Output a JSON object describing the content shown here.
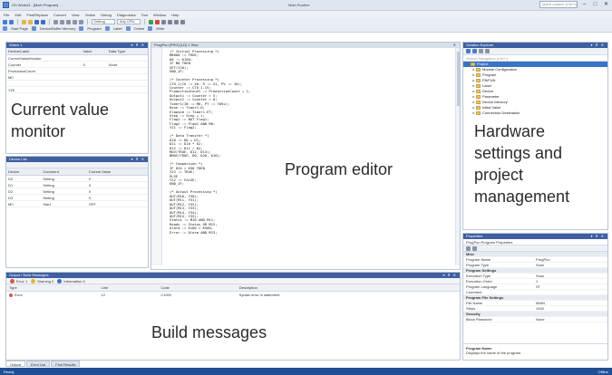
{
  "window": {
    "title": "GX Works3 - [Main Program] ...",
    "center_title": "Main Routine",
    "search_placeholder": "Quick Launch (Ctrl+Q)",
    "controls": [
      "–",
      "□",
      "✕"
    ]
  },
  "menu": [
    "File",
    "Edit",
    "Find/Replace",
    "Convert",
    "View",
    "Online",
    "Debug",
    "Diagnostics",
    "Tool",
    "Window",
    "Help"
  ],
  "toolbar": {
    "dropdown_1": "Debug",
    "dropdown_2": "Any CPU",
    "labels_row2": [
      "Start Page",
      "Device/Buffer Memory",
      "Program",
      "Label",
      "Online",
      "Write"
    ]
  },
  "monitor": {
    "overlay": [
      "Current value",
      "monitor"
    ],
    "header": "Watch 1",
    "columns": [
      "Device/Label",
      "Value",
      "Data Type"
    ],
    "rows": [
      [
        "CurrentValueMonitor",
        "",
        ""
      ],
      [
        "Counter",
        "0",
        "Word"
      ],
      [
        "ProductionCount",
        "",
        ""
      ],
      [
        "M0",
        "",
        ""
      ],
      [
        "",
        "",
        ""
      ],
      [
        "Y20",
        "",
        ""
      ]
    ]
  },
  "devices": {
    "header": "Device List",
    "columns": [
      "Device",
      "Comment",
      "Current Value"
    ],
    "rows": [
      [
        "D0",
        "Setting",
        "0"
      ],
      [
        "D1",
        "Setting",
        "0"
      ],
      [
        "D2",
        "Setting",
        "0"
      ],
      [
        "D3",
        "Setting",
        "0"
      ],
      [
        "M0",
        "Start",
        "OFF"
      ]
    ]
  },
  "editor": {
    "header": "ProgPou [PRG] [LD] 1 Step",
    "overlay": "Program editor",
    "lines": [
      "(* Initial Processing *)",
      "M8000 := TRUE;",
      "D0 := K100;",
      "IF M0 THEN",
      "  SET(Y20);",
      "END_IF;",
      "",
      "(* Counter Processing *)",
      "CTU_1(CU := X0, R := X1, PV := 10);",
      "Counter := CTU_1.CV;",
      "ProductionCount := ProductionCount + 1;",
      "Output1 := Counter > 5;",
      "Output2 := Counter > 8;",
      "Timer1(IN := M0, PT := T#5s);",
      "Done := Timer1.Q;",
      "Elapsed := Timer1.ET;",
      "Step := Step + 1;",
      "Flag1 := NOT Flag1;",
      "Flag2 := Flag1 AND M0;",
      "Y21 := Flag2;",
      "",
      "(* Data Transfer *)",
      "D10 := D0 + D1;",
      "D11 := D10 * K2;",
      "D12 := D11 / K4;",
      "MOV(TRUE, D12, D13);",
      "BMOV(TRUE, D0, D20, K10);",
      "",
      "(* Comparison *)",
      "IF D20 > K50 THEN",
      "  Y22 := TRUE;",
      "ELSE",
      "  Y22 := FALSE;",
      "END_IF;",
      "",
      "(* Output Processing *)",
      "OUT(M10, Y30);",
      "OUT(M11, Y31);",
      "OUT(M12, Y32);",
      "OUT(M13, Y33);",
      "OUT(M14, Y34);",
      "OUT(M15, Y35);",
      "Status := M10 AND M11;",
      "Ready := Status OR M12;",
      "Alarm := D100 > K500;",
      "Error := Alarm AND M13;"
    ]
  },
  "explorer": {
    "header": "Solution Explorer",
    "search_placeholder": "Search Navigation (Ctrl+;)",
    "overlay": [
      "Hardware",
      "settings and",
      "project",
      "management"
    ],
    "tree": [
      {
        "label": "Project",
        "level": 0,
        "selected": true
      },
      {
        "label": "Module Configuration",
        "level": 1,
        "selected": false
      },
      {
        "label": "Program",
        "level": 1,
        "selected": false
      },
      {
        "label": "FB/FUN",
        "level": 1,
        "selected": false
      },
      {
        "label": "Label",
        "level": 1,
        "selected": false
      },
      {
        "label": "Device",
        "level": 1,
        "selected": false
      },
      {
        "label": "Parameter",
        "level": 1,
        "selected": false
      },
      {
        "label": "Device Memory",
        "level": 1,
        "selected": false
      },
      {
        "label": "Initial Value",
        "level": 1,
        "selected": false
      },
      {
        "label": "Connection Destination",
        "level": 1,
        "selected": false
      }
    ]
  },
  "properties": {
    "header": "Properties",
    "selector": "ProgPou Program Properties",
    "rows": [
      {
        "key": "Misc",
        "value": "",
        "cat": true
      },
      {
        "key": "Program Name",
        "value": "ProgPou",
        "cat": false
      },
      {
        "key": "Program Type",
        "value": "Scan",
        "cat": false
      },
      {
        "key": "Program Settings",
        "value": "",
        "cat": true
      },
      {
        "key": "Execution Type",
        "value": "Scan",
        "cat": false
      },
      {
        "key": "Execution Order",
        "value": "1",
        "cat": false
      },
      {
        "key": "Program Language",
        "value": "ST",
        "cat": false
      },
      {
        "key": "Comment",
        "value": "",
        "cat": false
      },
      {
        "key": "Program File Settings",
        "value": "",
        "cat": true
      },
      {
        "key": "File Name",
        "value": "MAIN",
        "cat": false
      },
      {
        "key": "Steps",
        "value": "1000",
        "cat": false
      },
      {
        "key": "Security",
        "value": "",
        "cat": true
      },
      {
        "key": "Block Password",
        "value": "None",
        "cat": false
      }
    ],
    "description_title": "Program Name",
    "description": "Displays the name of the program."
  },
  "build": {
    "header": "Output / Build Messages",
    "overlay": "Build messages",
    "chips": [
      "Error 1",
      "Warning 0",
      "Information 0"
    ],
    "columns": [
      "Type",
      "Line",
      "Code",
      "Description"
    ],
    "rows": [
      [
        "Error",
        "12",
        "C1002",
        "Syntax error in statement"
      ]
    ]
  },
  "bottom_tabs": [
    "Output",
    "Error List",
    "Find Results"
  ],
  "status": {
    "left": "Ready",
    "right": "Offline"
  }
}
